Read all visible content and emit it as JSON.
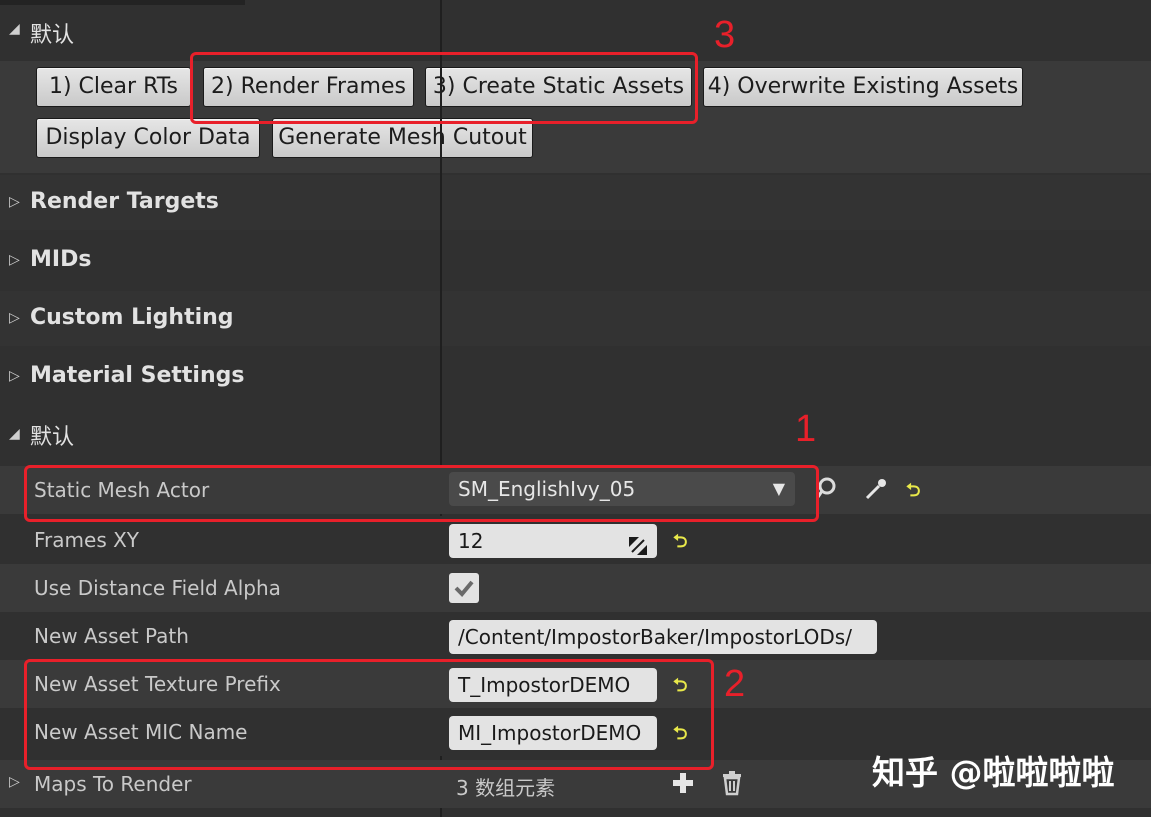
{
  "sections": {
    "default_top": "默认",
    "render_targets": "Render Targets",
    "mids": "MIDs",
    "custom_lighting": "Custom Lighting",
    "material_settings": "Material Settings",
    "default_bottom": "默认"
  },
  "buttons": {
    "clear_rts": "1) Clear RTs",
    "render_frames": "2) Render Frames",
    "create_static_assets": "3) Create Static Assets",
    "overwrite_existing": "4) Overwrite Existing Assets",
    "display_color_data": "Display Color Data",
    "generate_mesh_cutout": "Generate Mesh Cutout"
  },
  "properties": {
    "static_mesh_actor": {
      "label": "Static Mesh Actor",
      "value": "SM_EnglishIvy_05"
    },
    "frames_xy": {
      "label": "Frames XY",
      "value": "12"
    },
    "use_distance_field_alpha": {
      "label": "Use Distance Field Alpha",
      "checked": true
    },
    "new_asset_path": {
      "label": "New Asset Path",
      "value": "/Content/ImpostorBaker/ImpostorLODs/"
    },
    "new_asset_texture_prefix": {
      "label": "New Asset Texture Prefix",
      "value": "T_ImpostorDEMO"
    },
    "new_asset_mic_name": {
      "label": "New Asset MIC Name",
      "value": "MI_ImpostorDEMO"
    },
    "maps_to_render": {
      "label": "Maps To Render",
      "value": "3 数组元素"
    }
  },
  "annotations": {
    "one": "1",
    "two": "2",
    "three": "3"
  },
  "watermark": "知乎 @啦啦啦啦",
  "colors": {
    "annotation_red": "#e8202a",
    "reset_yellow": "#e8e84a",
    "panel_bg": "#303030"
  }
}
